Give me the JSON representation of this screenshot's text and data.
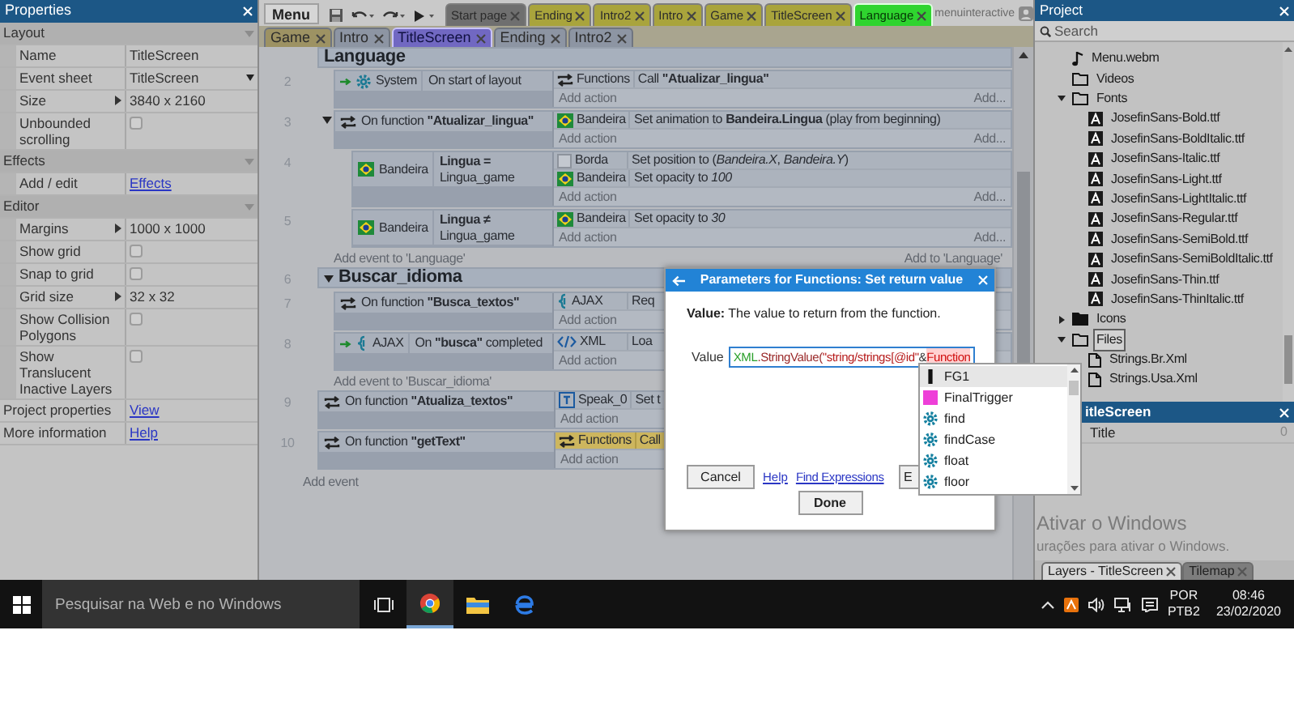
{
  "properties": {
    "title": "Properties",
    "rows": [
      {
        "kind": "section",
        "label": "Layout"
      },
      {
        "kind": "text",
        "label": "Name",
        "value": "TitleScreen"
      },
      {
        "kind": "dropdown",
        "label": "Event sheet",
        "value": "TitleScreen"
      },
      {
        "kind": "expandable",
        "label": "Size",
        "value": "3840 x 2160"
      },
      {
        "kind": "checkbox",
        "label": "Unbounded scrolling",
        "checked": false
      },
      {
        "kind": "section",
        "label": "Effects"
      },
      {
        "kind": "link",
        "label": "Add / edit",
        "value": "Effects"
      },
      {
        "kind": "section",
        "label": "Editor"
      },
      {
        "kind": "expandable",
        "label": "Margins",
        "value": "1000 x 1000"
      },
      {
        "kind": "checkbox",
        "label": "Show grid",
        "checked": false
      },
      {
        "kind": "checkbox",
        "label": "Snap to grid",
        "checked": false
      },
      {
        "kind": "expandable",
        "label": "Grid size",
        "value": "32 x 32"
      },
      {
        "kind": "checkbox",
        "label": "Show Collision Polygons",
        "checked": false
      },
      {
        "kind": "checkbox",
        "label": "Show Translucent Inactive Layers",
        "checked": false
      },
      {
        "kind": "toplink",
        "label": "Project properties",
        "value": "View"
      },
      {
        "kind": "toplink",
        "label": "More information",
        "value": "Help"
      }
    ]
  },
  "toolbar": {
    "menu": "Menu"
  },
  "layout_tabs": [
    {
      "label": "Start page",
      "color": "#6f6f6f",
      "selected": false
    },
    {
      "label": "Ending",
      "color": "#a9a43c",
      "selected": false
    },
    {
      "label": "Intro2",
      "color": "#a9a43c",
      "selected": false
    },
    {
      "label": "Intro",
      "color": "#a9a43c",
      "selected": false
    },
    {
      "label": "Game",
      "color": "#a9a43c",
      "selected": false
    },
    {
      "label": "TitleScreen",
      "color": "#a9a43c",
      "selected": false
    },
    {
      "label": "Language",
      "color": "#2fd42f",
      "selected": true
    }
  ],
  "account": "menuinteractive",
  "sheet_tabs": [
    {
      "label": "Game",
      "color": "#9d9263",
      "selected": false
    },
    {
      "label": "Intro",
      "color": "#8d95a3",
      "selected": false
    },
    {
      "label": "TitleScreen",
      "color": "#7168c2",
      "selected": true
    },
    {
      "label": "Ending",
      "color": "#8d95a3",
      "selected": false
    },
    {
      "label": "Intro2",
      "color": "#8d95a3",
      "selected": false
    }
  ],
  "event_sheet": {
    "items": [
      {
        "kind": "group",
        "title": "Language",
        "add_event": "Add event to 'Language'",
        "add_to": "Add to 'Language'",
        "children": [
          {
            "kind": "event",
            "number": "2",
            "trigger": true,
            "conditions": [
              {
                "object": "System",
                "kind": "gear",
                "text": "On start of layout"
              }
            ],
            "actions": [
              {
                "object": "Functions",
                "kind": "function",
                "text": "Call **\"Atualizar_lingua\"**",
                "selected": false
              }
            ],
            "add_action": "Add action",
            "add_more": "Add..."
          },
          {
            "kind": "event",
            "number": "3",
            "trigger": false,
            "expanded": true,
            "conditions": [
              {
                "kind": "function",
                "text": "On function **\"Atualizar_lingua\"**"
              }
            ],
            "actions": [
              {
                "object": "Bandeira",
                "kind": "flag",
                "text": "Set animation to **Bandeira.Lingua** (play from beginning)",
                "selected": false
              }
            ],
            "add_action": "Add action",
            "add_more": "Add...",
            "children": [
              {
                "kind": "event",
                "number": "4",
                "trigger": false,
                "conditions": [
                  {
                    "object": "Bandeira",
                    "kind": "flag",
                    "text": "**Lingua =** Lingua_game"
                  }
                ],
                "actions": [
                  {
                    "object": "Borda",
                    "kind": "blank",
                    "text": "Set position to (*Bandeira.X*, *Bandeira.Y*)",
                    "selected": false
                  },
                  {
                    "object": "Bandeira",
                    "kind": "flag",
                    "text": "Set opacity to *100*",
                    "selected": false
                  }
                ],
                "add_action": "Add action",
                "add_more": "Add..."
              },
              {
                "kind": "event",
                "number": "5",
                "trigger": false,
                "conditions": [
                  {
                    "object": "Bandeira",
                    "kind": "flag",
                    "text": "**Lingua ≠** Lingua_game"
                  }
                ],
                "actions": [
                  {
                    "object": "Bandeira",
                    "kind": "flag",
                    "text": "Set opacity to *30*",
                    "selected": false
                  }
                ],
                "add_action": "Add action",
                "add_more": "Add..."
              }
            ]
          }
        ]
      },
      {
        "kind": "group",
        "number": "6",
        "title": "Buscar_idioma",
        "expanded": true,
        "add_event": "Add event to 'Buscar_idioma'",
        "children": [
          {
            "kind": "event",
            "number": "7",
            "trigger": false,
            "conditions": [
              {
                "kind": "function",
                "text": "On function **\"Busca_textos\"**"
              }
            ],
            "actions": [
              {
                "object": "AJAX",
                "kind": "ajax",
                "text": "Req",
                "selected": false
              }
            ],
            "add_action": "Add action"
          },
          {
            "kind": "event",
            "number": "8",
            "trigger": true,
            "conditions": [
              {
                "object": "AJAX",
                "kind": "ajax",
                "text": "On **\"busca\"** completed"
              }
            ],
            "actions": [
              {
                "object": "XML",
                "kind": "xml",
                "text": "Loa",
                "selected": false
              }
            ],
            "add_action": "Add action"
          }
        ]
      },
      {
        "kind": "event",
        "number": "9",
        "trigger": false,
        "conditions": [
          {
            "kind": "function",
            "text": "On function **\"Atualiza_textos\"**"
          }
        ],
        "actions": [
          {
            "object": "Speak_0",
            "kind": "text",
            "text": "Set t",
            "selected": false
          }
        ],
        "add_action": "Add action"
      },
      {
        "kind": "event",
        "number": "10",
        "trigger": false,
        "conditions": [
          {
            "kind": "function",
            "text": "On function **\"getText\"**"
          }
        ],
        "actions": [
          {
            "object": "Functions",
            "kind": "function",
            "text": "Call",
            "selected": true
          }
        ],
        "add_action": "Add action"
      }
    ],
    "add_event": "Add event"
  },
  "dialog": {
    "title": "Parameters for Functions: Set return value",
    "description": "**Value:** The value to return from the function.",
    "field_label": "Value",
    "value": [
      {
        "kind": "object",
        "text": "XML"
      },
      {
        "kind": "method",
        "text": ".StringValue("
      },
      {
        "kind": "string",
        "text": "\"string/strings[@id\""
      },
      {
        "kind": "operator",
        "text": " & "
      },
      {
        "kind": "error",
        "text": "Function"
      }
    ],
    "cancel": "Cancel",
    "help": "Help",
    "find": "Find Expressions",
    "extra": "E",
    "done": "Done"
  },
  "autocomplete": [
    {
      "kind": "instance",
      "label": "FG1",
      "selected": true
    },
    {
      "kind": "object",
      "label": "FinalTrigger",
      "selected": false
    },
    {
      "kind": "expression",
      "label": "find",
      "selected": false
    },
    {
      "kind": "expression",
      "label": "findCase",
      "selected": false
    },
    {
      "kind": "expression",
      "label": "float",
      "selected": false
    },
    {
      "kind": "expression",
      "label": "floor",
      "selected": false
    }
  ],
  "project": {
    "title": "Project",
    "search_placeholder": "Search",
    "tree": [
      {
        "kind": "audio",
        "label": "Menu.webm",
        "selected": false
      },
      {
        "kind": "folder",
        "label": "Videos",
        "selected": false
      },
      {
        "kind": "folder",
        "label": "Fonts",
        "expanded": true,
        "selected": false,
        "children": [
          {
            "kind": "font",
            "label": "JosefinSans-Bold.ttf",
            "selected": false
          },
          {
            "kind": "font",
            "label": "JosefinSans-BoldItalic.ttf",
            "selected": false
          },
          {
            "kind": "font",
            "label": "JosefinSans-Italic.ttf",
            "selected": false
          },
          {
            "kind": "font",
            "label": "JosefinSans-Light.ttf",
            "selected": false
          },
          {
            "kind": "font",
            "label": "JosefinSans-LightItalic.ttf",
            "selected": false
          },
          {
            "kind": "font",
            "label": "JosefinSans-Regular.ttf",
            "selected": false
          },
          {
            "kind": "font",
            "label": "JosefinSans-SemiBold.ttf",
            "selected": false
          },
          {
            "kind": "font",
            "label": "JosefinSans-SemiBoldItalic.ttf",
            "selected": false
          },
          {
            "kind": "font",
            "label": "JosefinSans-Thin.ttf",
            "selected": false
          },
          {
            "kind": "font",
            "label": "JosefinSans-ThinItalic.ttf",
            "selected": false
          }
        ]
      },
      {
        "kind": "folder",
        "label": "Icons",
        "expanded": false,
        "selected": false
      },
      {
        "kind": "folder",
        "label": "Files",
        "expanded": true,
        "selected": true,
        "children": [
          {
            "kind": "file",
            "label": "Strings.Br.Xml",
            "selected": false
          },
          {
            "kind": "file",
            "label": "Strings.Usa.Xml",
            "selected": false
          }
        ]
      }
    ]
  },
  "layers": {
    "title": "itleScreen",
    "rows": [
      {
        "name": "Title",
        "value": "0"
      }
    ]
  },
  "bottom_tabs": [
    {
      "label": "Layers - TitleScreen",
      "selected": true
    },
    {
      "label": "Tilemap",
      "selected": false
    }
  ],
  "activation": [
    "Ativar o Windows",
    "urações para ativar o Windows."
  ],
  "taskbar": {
    "search_placeholder": "Pesquisar na Web e no Windows",
    "language": [
      "POR",
      "PTB2"
    ],
    "time": "08:46",
    "date": "23/02/2020"
  }
}
